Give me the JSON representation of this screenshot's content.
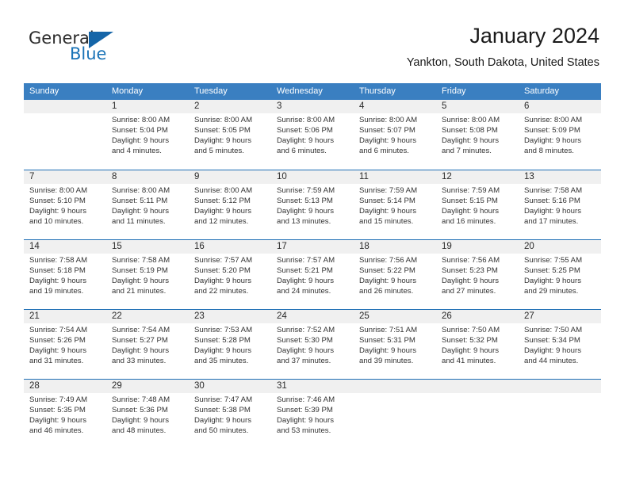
{
  "logo": {
    "word1": "General",
    "word2": "Blue",
    "accent_color": "#1565a8",
    "text_color": "#1a73b7"
  },
  "header": {
    "month_title": "January 2024",
    "location": "Yankton, South Dakota, United States"
  },
  "theme": {
    "header_bar_color": "#3a7fc1",
    "row_divider_color": "#1f6fb5",
    "day_band_color": "#f0f0f0"
  },
  "weekdays": [
    "Sunday",
    "Monday",
    "Tuesday",
    "Wednesday",
    "Thursday",
    "Friday",
    "Saturday"
  ],
  "weeks": [
    [
      {
        "day": "",
        "sunrise": "",
        "sunset": "",
        "daylight1": "",
        "daylight2": ""
      },
      {
        "day": "1",
        "sunrise": "Sunrise: 8:00 AM",
        "sunset": "Sunset: 5:04 PM",
        "daylight1": "Daylight: 9 hours",
        "daylight2": "and 4 minutes."
      },
      {
        "day": "2",
        "sunrise": "Sunrise: 8:00 AM",
        "sunset": "Sunset: 5:05 PM",
        "daylight1": "Daylight: 9 hours",
        "daylight2": "and 5 minutes."
      },
      {
        "day": "3",
        "sunrise": "Sunrise: 8:00 AM",
        "sunset": "Sunset: 5:06 PM",
        "daylight1": "Daylight: 9 hours",
        "daylight2": "and 6 minutes."
      },
      {
        "day": "4",
        "sunrise": "Sunrise: 8:00 AM",
        "sunset": "Sunset: 5:07 PM",
        "daylight1": "Daylight: 9 hours",
        "daylight2": "and 6 minutes."
      },
      {
        "day": "5",
        "sunrise": "Sunrise: 8:00 AM",
        "sunset": "Sunset: 5:08 PM",
        "daylight1": "Daylight: 9 hours",
        "daylight2": "and 7 minutes."
      },
      {
        "day": "6",
        "sunrise": "Sunrise: 8:00 AM",
        "sunset": "Sunset: 5:09 PM",
        "daylight1": "Daylight: 9 hours",
        "daylight2": "and 8 minutes."
      }
    ],
    [
      {
        "day": "7",
        "sunrise": "Sunrise: 8:00 AM",
        "sunset": "Sunset: 5:10 PM",
        "daylight1": "Daylight: 9 hours",
        "daylight2": "and 10 minutes."
      },
      {
        "day": "8",
        "sunrise": "Sunrise: 8:00 AM",
        "sunset": "Sunset: 5:11 PM",
        "daylight1": "Daylight: 9 hours",
        "daylight2": "and 11 minutes."
      },
      {
        "day": "9",
        "sunrise": "Sunrise: 8:00 AM",
        "sunset": "Sunset: 5:12 PM",
        "daylight1": "Daylight: 9 hours",
        "daylight2": "and 12 minutes."
      },
      {
        "day": "10",
        "sunrise": "Sunrise: 7:59 AM",
        "sunset": "Sunset: 5:13 PM",
        "daylight1": "Daylight: 9 hours",
        "daylight2": "and 13 minutes."
      },
      {
        "day": "11",
        "sunrise": "Sunrise: 7:59 AM",
        "sunset": "Sunset: 5:14 PM",
        "daylight1": "Daylight: 9 hours",
        "daylight2": "and 15 minutes."
      },
      {
        "day": "12",
        "sunrise": "Sunrise: 7:59 AM",
        "sunset": "Sunset: 5:15 PM",
        "daylight1": "Daylight: 9 hours",
        "daylight2": "and 16 minutes."
      },
      {
        "day": "13",
        "sunrise": "Sunrise: 7:58 AM",
        "sunset": "Sunset: 5:16 PM",
        "daylight1": "Daylight: 9 hours",
        "daylight2": "and 17 minutes."
      }
    ],
    [
      {
        "day": "14",
        "sunrise": "Sunrise: 7:58 AM",
        "sunset": "Sunset: 5:18 PM",
        "daylight1": "Daylight: 9 hours",
        "daylight2": "and 19 minutes."
      },
      {
        "day": "15",
        "sunrise": "Sunrise: 7:58 AM",
        "sunset": "Sunset: 5:19 PM",
        "daylight1": "Daylight: 9 hours",
        "daylight2": "and 21 minutes."
      },
      {
        "day": "16",
        "sunrise": "Sunrise: 7:57 AM",
        "sunset": "Sunset: 5:20 PM",
        "daylight1": "Daylight: 9 hours",
        "daylight2": "and 22 minutes."
      },
      {
        "day": "17",
        "sunrise": "Sunrise: 7:57 AM",
        "sunset": "Sunset: 5:21 PM",
        "daylight1": "Daylight: 9 hours",
        "daylight2": "and 24 minutes."
      },
      {
        "day": "18",
        "sunrise": "Sunrise: 7:56 AM",
        "sunset": "Sunset: 5:22 PM",
        "daylight1": "Daylight: 9 hours",
        "daylight2": "and 26 minutes."
      },
      {
        "day": "19",
        "sunrise": "Sunrise: 7:56 AM",
        "sunset": "Sunset: 5:23 PM",
        "daylight1": "Daylight: 9 hours",
        "daylight2": "and 27 minutes."
      },
      {
        "day": "20",
        "sunrise": "Sunrise: 7:55 AM",
        "sunset": "Sunset: 5:25 PM",
        "daylight1": "Daylight: 9 hours",
        "daylight2": "and 29 minutes."
      }
    ],
    [
      {
        "day": "21",
        "sunrise": "Sunrise: 7:54 AM",
        "sunset": "Sunset: 5:26 PM",
        "daylight1": "Daylight: 9 hours",
        "daylight2": "and 31 minutes."
      },
      {
        "day": "22",
        "sunrise": "Sunrise: 7:54 AM",
        "sunset": "Sunset: 5:27 PM",
        "daylight1": "Daylight: 9 hours",
        "daylight2": "and 33 minutes."
      },
      {
        "day": "23",
        "sunrise": "Sunrise: 7:53 AM",
        "sunset": "Sunset: 5:28 PM",
        "daylight1": "Daylight: 9 hours",
        "daylight2": "and 35 minutes."
      },
      {
        "day": "24",
        "sunrise": "Sunrise: 7:52 AM",
        "sunset": "Sunset: 5:30 PM",
        "daylight1": "Daylight: 9 hours",
        "daylight2": "and 37 minutes."
      },
      {
        "day": "25",
        "sunrise": "Sunrise: 7:51 AM",
        "sunset": "Sunset: 5:31 PM",
        "daylight1": "Daylight: 9 hours",
        "daylight2": "and 39 minutes."
      },
      {
        "day": "26",
        "sunrise": "Sunrise: 7:50 AM",
        "sunset": "Sunset: 5:32 PM",
        "daylight1": "Daylight: 9 hours",
        "daylight2": "and 41 minutes."
      },
      {
        "day": "27",
        "sunrise": "Sunrise: 7:50 AM",
        "sunset": "Sunset: 5:34 PM",
        "daylight1": "Daylight: 9 hours",
        "daylight2": "and 44 minutes."
      }
    ],
    [
      {
        "day": "28",
        "sunrise": "Sunrise: 7:49 AM",
        "sunset": "Sunset: 5:35 PM",
        "daylight1": "Daylight: 9 hours",
        "daylight2": "and 46 minutes."
      },
      {
        "day": "29",
        "sunrise": "Sunrise: 7:48 AM",
        "sunset": "Sunset: 5:36 PM",
        "daylight1": "Daylight: 9 hours",
        "daylight2": "and 48 minutes."
      },
      {
        "day": "30",
        "sunrise": "Sunrise: 7:47 AM",
        "sunset": "Sunset: 5:38 PM",
        "daylight1": "Daylight: 9 hours",
        "daylight2": "and 50 minutes."
      },
      {
        "day": "31",
        "sunrise": "Sunrise: 7:46 AM",
        "sunset": "Sunset: 5:39 PM",
        "daylight1": "Daylight: 9 hours",
        "daylight2": "and 53 minutes."
      },
      {
        "day": "",
        "sunrise": "",
        "sunset": "",
        "daylight1": "",
        "daylight2": ""
      },
      {
        "day": "",
        "sunrise": "",
        "sunset": "",
        "daylight1": "",
        "daylight2": ""
      },
      {
        "day": "",
        "sunrise": "",
        "sunset": "",
        "daylight1": "",
        "daylight2": ""
      }
    ]
  ]
}
